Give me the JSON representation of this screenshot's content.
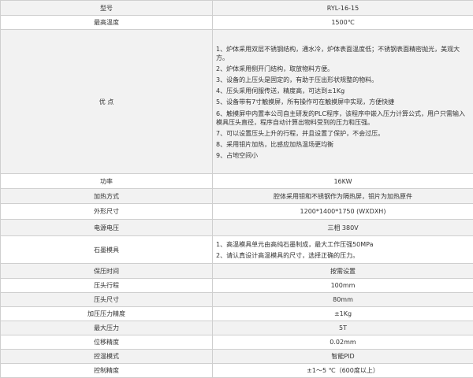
{
  "rows": [
    {
      "label": "型号",
      "value": "RYL-16-15"
    },
    {
      "label": "最高温度",
      "value": "1500℃"
    },
    {
      "label": "优  点",
      "items": [
        "1、炉体采用双层不锈钢结构，通水冷，炉体表面温度低；不锈钢表面精密抛光，美观大方。",
        "2、炉体采用侧开门结构，取放物料方便。",
        "3、设备的上压头是固定的，有助于压出形状规整的物料。",
        "4、压头采用伺服传送，精度高，可达到±1Kg",
        "5、设备带有7寸触摸屏，所有操作可在触摸屏中实现，方便快捷",
        "6、触摸屏中内置本公司自主研发的PLC程序，该程序中嵌入压力计算公式，用户只需输入模具压头直径，程序自动计算出物料受到的压力和压强。",
        "7、可以设置压头上升的行程，并且设置了保护，不会过压。",
        "8、采用钼片加热，比感应加热温场更均衡",
        "9、占地空间小"
      ]
    },
    {
      "label": "功率",
      "value": "16KW"
    },
    {
      "label": "加热方式",
      "value": "腔体采用钼和不锈钢作为隔热屏，钼片为加热原件"
    },
    {
      "label": "外形尺寸",
      "value": "1200*1400*1750  (WXDXH)"
    },
    {
      "label": "电源电压",
      "value": "三相  380V"
    },
    {
      "label": "石墨模具",
      "items": [
        "1、高温模具单元由高纯石墨制成，最大工作压强50MPa",
        "2、请认真设计高温模具的尺寸，选择正确的压力。"
      ]
    },
    {
      "label": "保压时间",
      "value": "按需设置"
    },
    {
      "label": "压头行程",
      "value": "100mm"
    },
    {
      "label": "压头尺寸",
      "value": "80mm"
    },
    {
      "label": "加压压力精度",
      "value": "±1Kg"
    },
    {
      "label": "最大压力",
      "value": "5T"
    },
    {
      "label": "位移精度",
      "value": "0.02mm"
    },
    {
      "label": "控温模式",
      "value": "智能PID"
    },
    {
      "label": "控制精度",
      "value": "±1～5 ℃（600度以上）"
    }
  ]
}
